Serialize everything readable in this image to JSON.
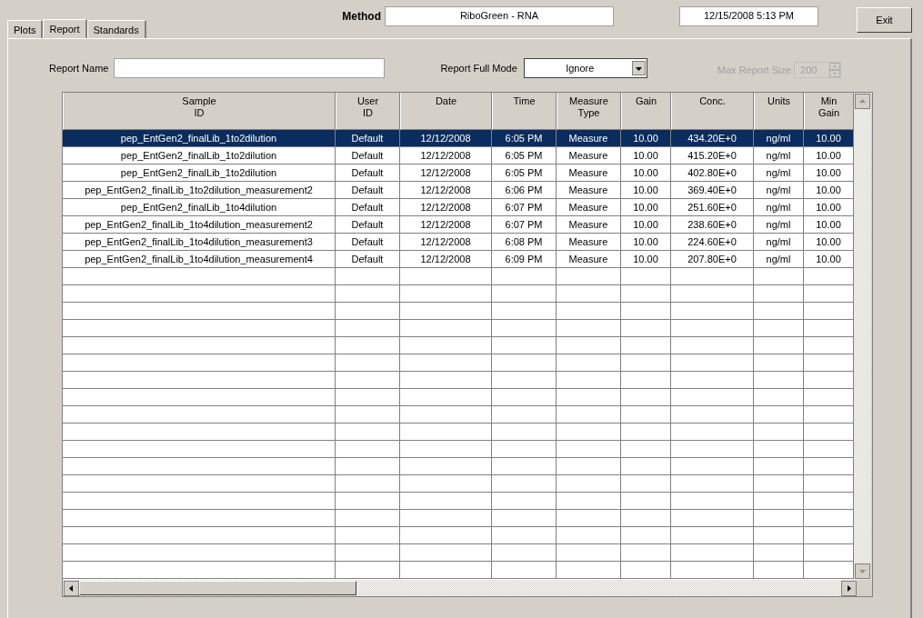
{
  "tabs": [
    {
      "label": "Plots",
      "selected": false
    },
    {
      "label": "Report",
      "selected": true
    },
    {
      "label": "Standards",
      "selected": false
    }
  ],
  "method": {
    "label": "Method",
    "value": "RiboGreen - RNA"
  },
  "datetime": "12/15/2008  5:13 PM",
  "exit_button": "Exit",
  "report_name": {
    "label": "Report Name"
  },
  "report_full_mode": {
    "label": "Report Full Mode",
    "value": "Ignore"
  },
  "max_report_size": {
    "label": "Max Report Size",
    "value": "200",
    "disabled": true
  },
  "table": {
    "columns": [
      "Sample\nID",
      "User\nID",
      "Date",
      "Time",
      "Measure\nType",
      "Gain",
      "Conc.",
      "Units",
      "Min\nGain"
    ],
    "rows": [
      {
        "selected": true,
        "cells": [
          "pep_EntGen2_finalLib_1to2dilution",
          "Default",
          "12/12/2008",
          "6:05 PM",
          "Measure",
          "10.00",
          "434.20E+0",
          "ng/ml",
          "10.00"
        ]
      },
      {
        "selected": false,
        "cells": [
          "pep_EntGen2_finalLib_1to2dilution",
          "Default",
          "12/12/2008",
          "6:05 PM",
          "Measure",
          "10.00",
          "415.20E+0",
          "ng/ml",
          "10.00"
        ]
      },
      {
        "selected": false,
        "cells": [
          "pep_EntGen2_finalLib_1to2dilution",
          "Default",
          "12/12/2008",
          "6:05 PM",
          "Measure",
          "10.00",
          "402.80E+0",
          "ng/ml",
          "10.00"
        ]
      },
      {
        "selected": false,
        "cells": [
          "pep_EntGen2_finalLib_1to2dilution_measurement2",
          "Default",
          "12/12/2008",
          "6:06 PM",
          "Measure",
          "10.00",
          "369.40E+0",
          "ng/ml",
          "10.00"
        ]
      },
      {
        "selected": false,
        "cells": [
          "pep_EntGen2_finalLib_1to4dilution",
          "Default",
          "12/12/2008",
          "6:07 PM",
          "Measure",
          "10.00",
          "251.60E+0",
          "ng/ml",
          "10.00"
        ]
      },
      {
        "selected": false,
        "cells": [
          "pep_EntGen2_finalLib_1to4dilution_measurement2",
          "Default",
          "12/12/2008",
          "6:07 PM",
          "Measure",
          "10.00",
          "238.60E+0",
          "ng/ml",
          "10.00"
        ]
      },
      {
        "selected": false,
        "cells": [
          "pep_EntGen2_finalLib_1to4dilution_measurement3",
          "Default",
          "12/12/2008",
          "6:08 PM",
          "Measure",
          "10.00",
          "224.60E+0",
          "ng/ml",
          "10.00"
        ]
      },
      {
        "selected": false,
        "cells": [
          "pep_EntGen2_finalLib_1to4dilution_measurement4",
          "Default",
          "12/12/2008",
          "6:09 PM",
          "Measure",
          "10.00",
          "207.80E+0",
          "ng/ml",
          "10.00"
        ]
      }
    ]
  }
}
